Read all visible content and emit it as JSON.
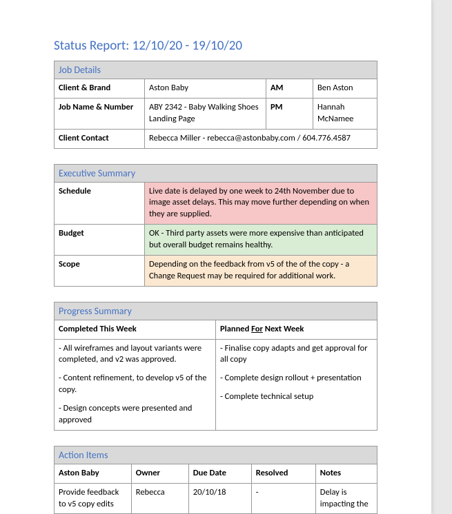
{
  "title": "Status Report: 12/10/20 - 19/10/20",
  "job_details": {
    "section_title": "Job Details",
    "labels": {
      "client_brand": "Client & Brand",
      "am": "AM",
      "job_name_number": "Job Name & Number",
      "pm": "PM",
      "client_contact": "Client Contact"
    },
    "values": {
      "client_brand": "Aston Baby",
      "am": "Ben Aston",
      "job_name_number": "ABY 2342 - Baby Walking Shoes Landing Page",
      "pm": "Hannah McNamee",
      "client_contact": "Rebecca Miller - rebecca@astonbaby.com / 604.776.4587"
    }
  },
  "executive_summary": {
    "section_title": "Executive Summary",
    "rows": {
      "schedule": {
        "label": "Schedule",
        "text": "Live date is delayed by one week to 24th November due to image asset delays. This may move further depending on when they are supplied.",
        "status_color": "red"
      },
      "budget": {
        "label": "Budget",
        "text": "OK - Third party assets were more expensive than anticipated but overall budget remains healthy.",
        "status_color": "green"
      },
      "scope": {
        "label": "Scope",
        "text": "Depending on the feedback from v5 of the of the copy - a Change Request may be required for additional work.",
        "status_color": "amber"
      }
    }
  },
  "progress_summary": {
    "section_title": "Progress Summary",
    "headers": {
      "completed": "Completed This Week",
      "planned_prefix": "Planned ",
      "planned_underlined": "For",
      "planned_suffix": " Next Week"
    },
    "completed": {
      "line1": "- All wireframes and layout variants were completed, and v2 was approved.",
      "line2": "- Content refinement, to develop v5 of the copy.",
      "line3": "- Design concepts were presented and approved"
    },
    "planned": {
      "line1": "- Finalise copy adapts and get approval for all copy",
      "line2": "- Complete design rollout + presentation",
      "line3": "- Complete technical setup"
    }
  },
  "action_items": {
    "section_title": "Action Items",
    "headers": {
      "group": "Aston Baby",
      "owner": "Owner",
      "due": "Due Date",
      "resolved": "Resolved",
      "notes": "Notes"
    },
    "rows": [
      {
        "task": "Provide feedback to v5 copy edits",
        "owner": "Rebecca",
        "due": "20/10/18",
        "resolved": "-",
        "notes": "Delay is impacting the"
      }
    ]
  }
}
